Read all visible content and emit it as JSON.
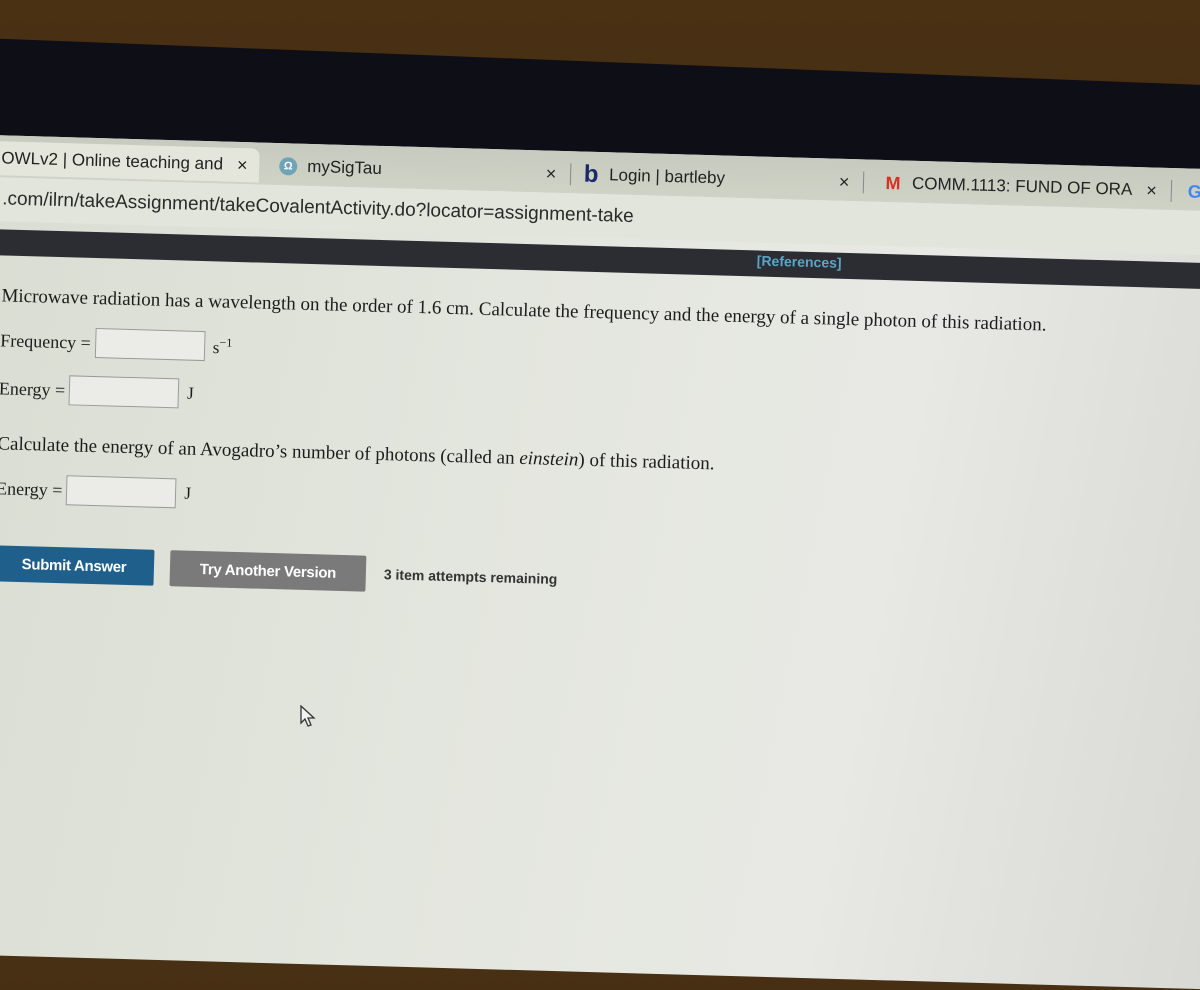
{
  "browser": {
    "tabs": [
      {
        "title": "OWLv2 | Online teaching and",
        "icon": "owl-dot-icon",
        "active": true
      },
      {
        "title": "mySigTau",
        "icon": "sigtau-icon",
        "active": false
      },
      {
        "title": "Login | bartleby",
        "icon": "bartleby-b-icon",
        "active": false
      },
      {
        "title": "COMM.1113: FUND OF ORA",
        "icon": "gmail-icon",
        "active": false
      }
    ],
    "close_glyph": "×",
    "next_tab_icon_glyph": "G",
    "url": ".com/ilrn/takeAssignment/takeCovalentActivity.do?locator=assignment-take"
  },
  "page": {
    "references_link": "[References]",
    "question": "Microwave radiation has a wavelength on the order of 1.6 cm. Calculate the frequency and the energy of a single photon of this radiation.",
    "fields": [
      {
        "label": "Frequency =",
        "value": "",
        "unit_base": "s",
        "unit_sup": "−1"
      },
      {
        "label": "Energy =",
        "value": "",
        "unit_base": "J",
        "unit_sup": ""
      }
    ],
    "question2_pre": "Calculate the energy of an Avogadro’s number of photons (called an ",
    "question2_em": "einstein",
    "question2_post": ") of this radiation.",
    "field3": {
      "label": "Energy =",
      "value": "",
      "unit_base": "J"
    },
    "buttons": {
      "submit": "Submit Answer",
      "try_another": "Try Another Version"
    },
    "attempts_text": "3 item attempts remaining"
  },
  "colors": {
    "submit_bg": "#1f5f8b",
    "try_bg": "#7a7a7a",
    "references": "#5aa6c9",
    "header_bar": "#2b2d33"
  }
}
